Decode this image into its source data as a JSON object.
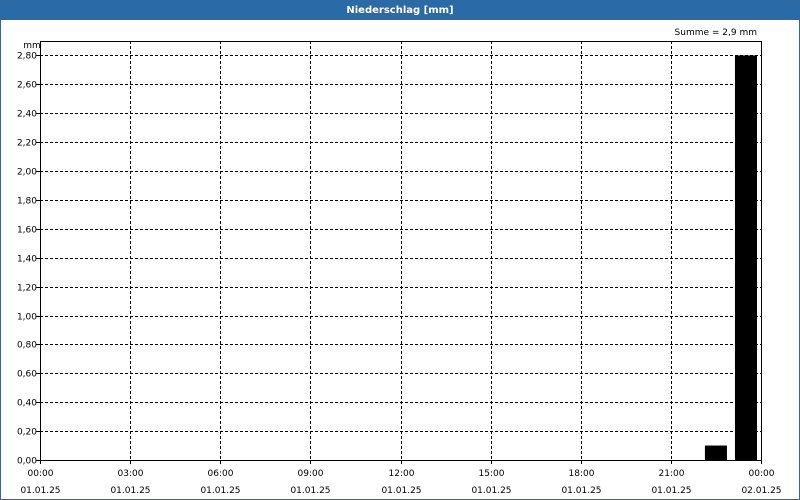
{
  "window": {
    "title": "Niederschlag [mm]"
  },
  "chart_data": {
    "type": "bar",
    "y_unit": "mm",
    "annotation": "Summe = 2,9 mm",
    "ylim": [
      0,
      2.9
    ],
    "yticks": [
      0,
      0.2,
      0.4,
      0.6,
      0.8,
      1.0,
      1.2,
      1.4,
      1.6,
      1.8,
      2.0,
      2.2,
      2.4,
      2.6,
      2.8
    ],
    "ytick_labels": [
      "0,00",
      "0,20",
      "0,40",
      "0,60",
      "0,80",
      "1,00",
      "1,20",
      "1,40",
      "1,60",
      "1,80",
      "2,00",
      "2,20",
      "2,40",
      "2,60",
      "2,80"
    ],
    "x_range": [
      "00:00",
      "24:00"
    ],
    "x_ticks": [
      {
        "time": "00:00",
        "label_time": "00:00",
        "label_date": "01.01.25"
      },
      {
        "time": "03:00",
        "label_time": "03:00",
        "label_date": "01.01.25"
      },
      {
        "time": "06:00",
        "label_time": "06:00",
        "label_date": "01.01.25"
      },
      {
        "time": "09:00",
        "label_time": "09:00",
        "label_date": "01.01.25"
      },
      {
        "time": "12:00",
        "label_time": "12:00",
        "label_date": "01.01.25"
      },
      {
        "time": "15:00",
        "label_time": "15:00",
        "label_date": "01.01.25"
      },
      {
        "time": "18:00",
        "label_time": "18:00",
        "label_date": "01.01.25"
      },
      {
        "time": "21:00",
        "label_time": "21:00",
        "label_date": "01.01.25"
      },
      {
        "time": "24:00",
        "label_time": "00:00",
        "label_date": "02.01.25"
      }
    ],
    "bars": [
      {
        "start": "22:00",
        "end": "23:00",
        "value": 0.1
      },
      {
        "start": "23:00",
        "end": "24:00",
        "value": 2.8
      }
    ],
    "grid": true,
    "bar_color": "#000000"
  }
}
